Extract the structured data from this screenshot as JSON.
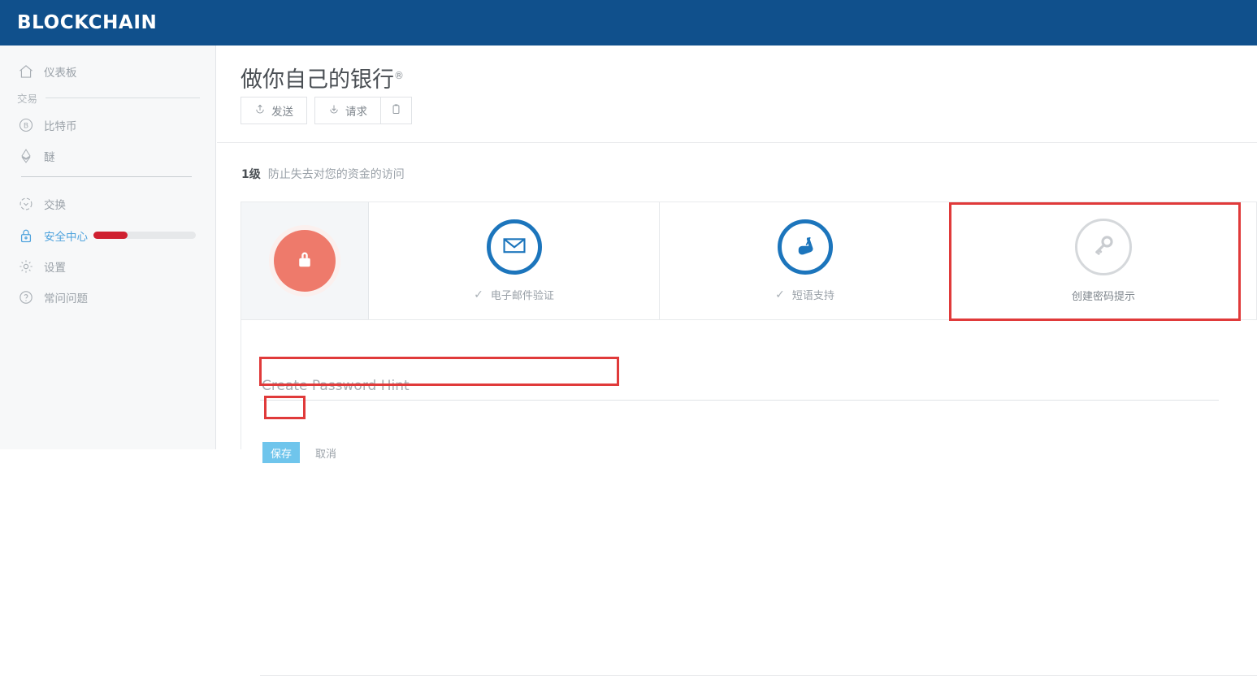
{
  "header": {
    "brand": "BLOCKCHAIN",
    "bg_color": "#10508c"
  },
  "sidebar": {
    "items": [
      {
        "label": "仪表板",
        "icon": "home-icon",
        "name": "dashboard"
      },
      {
        "label": "比特币",
        "icon": "bitcoin-icon",
        "name": "bitcoin"
      },
      {
        "label": "醚",
        "icon": "ethereum-icon",
        "name": "ether"
      },
      {
        "label": "交换",
        "icon": "exchange-icon",
        "name": "exchange"
      },
      {
        "label": "安全中心",
        "icon": "lock-icon",
        "name": "security-center"
      },
      {
        "label": "设置",
        "icon": "gear-icon",
        "name": "settings"
      },
      {
        "label": "常问问题",
        "icon": "question-icon",
        "name": "faq"
      }
    ],
    "section_label": "交易",
    "security_progress_percent": 33,
    "progress_fill_color": "#cf2030",
    "active_item": "安全中心",
    "active_color": "#4fa3dd"
  },
  "main": {
    "title": "做你自己的银行",
    "title_reg_mark": "®",
    "actions": {
      "send_label": "发送",
      "send_icon": "upload-arrow-icon",
      "request_label": "请求",
      "request_icon": "download-arrow-icon",
      "copy_icon": "clipboard-icon"
    },
    "level": {
      "badge": "1级",
      "description": "防止失去对您的资金的访问"
    },
    "steps": [
      {
        "name": "security-lock",
        "label": "",
        "icon": "lock-icon",
        "state": "indicator",
        "color": "#ee7a6b"
      },
      {
        "name": "email-verification",
        "label": "电子邮件验证",
        "icon": "envelope-icon",
        "state": "completed",
        "check": "✓",
        "color": "#1c75bc"
      },
      {
        "name": "sms-support",
        "label": "短语支持",
        "icon": "phone-hand-icon",
        "state": "completed",
        "check": "✓",
        "color": "#1c75bc"
      },
      {
        "name": "create-password-hint",
        "label": "创建密码提示",
        "icon": "key-icon",
        "state": "pending",
        "check": "",
        "color": "#d5d8db",
        "highlighted": true
      }
    ],
    "form": {
      "hint_placeholder": "Create Password Hint",
      "hint_value": "",
      "save_label": "保存",
      "save_color": "#6fc5ec",
      "cancel_label": "取消"
    }
  },
  "annotations": {
    "highlight_color": "#e03a3a"
  }
}
